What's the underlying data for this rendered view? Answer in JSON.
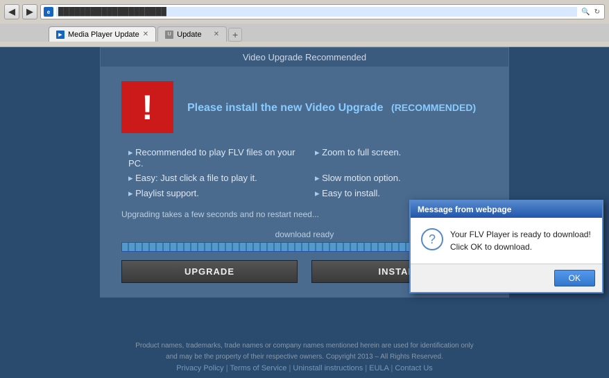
{
  "browser": {
    "back_label": "◀",
    "forward_label": "▶",
    "address_text": "████████████████████",
    "refresh_label": "↻",
    "tab1": {
      "label": "Media Player Update",
      "close": "✕"
    },
    "tab2": {
      "label": "Update",
      "close": "✕"
    }
  },
  "card": {
    "header": "Video Upgrade Recommended",
    "title": "Please install the new Video Upgrade",
    "recommended": "(RECOMMENDED)",
    "features": [
      "Recommended to play FLV files on your PC.",
      "Zoom to full screen.",
      "Easy: Just click a file to play it.",
      "Slow motion option.",
      "Playlist support.",
      "Easy to install."
    ],
    "upgrade_note": "Upgrading takes a few seconds and no restart need...",
    "progress_label": "download ready",
    "upgrade_btn": "UPGRADE",
    "install_btn": "INSTALL"
  },
  "dialog": {
    "title": "Message from webpage",
    "message_line1": "Your FLV Player is ready to download!",
    "message_line2": "Click OK to download.",
    "ok_label": "OK"
  },
  "footer": {
    "disclaimer": "Product names, trademarks, trade names or company names mentioned herein are used for identification only",
    "disclaimer2": "and may be the property of their respective owners. Copyright 2013 – All Rights Reserved.",
    "links": {
      "privacy": "Privacy Policy",
      "terms": "Terms of Service",
      "uninstall": "Uninstall instructions",
      "eula": "EULA",
      "contact": "Contact Us"
    }
  }
}
